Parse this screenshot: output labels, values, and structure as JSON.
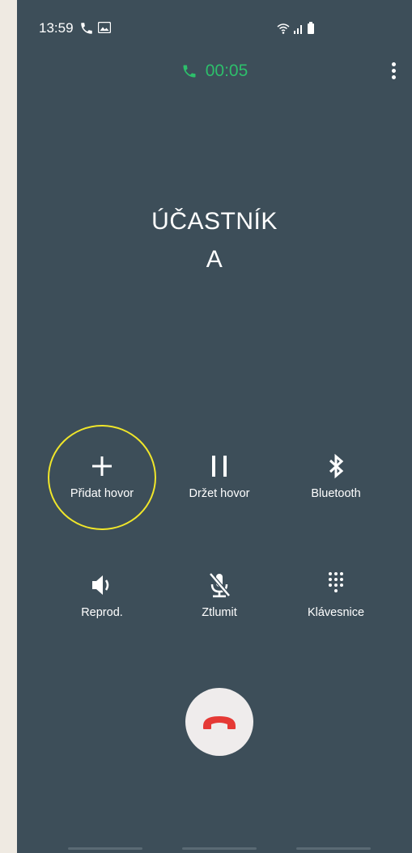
{
  "status_bar": {
    "time": "13:59",
    "left_icons": [
      "phone-icon",
      "gallery-icon"
    ],
    "right_icons": [
      "wifi-icon",
      "signal-icon",
      "battery-icon"
    ]
  },
  "call": {
    "duration": "00:05",
    "contact_line1": "ÚČASTNÍK",
    "contact_line2": "A",
    "accent_color": "#2dbf6b"
  },
  "controls": [
    {
      "id": "add-call",
      "label": "Přidat hovor",
      "icon": "plus-icon",
      "highlighted": true
    },
    {
      "id": "hold",
      "label": "Držet hovor",
      "icon": "pause-icon"
    },
    {
      "id": "bluetooth",
      "label": "Bluetooth",
      "icon": "bluetooth-icon"
    },
    {
      "id": "speaker",
      "label": "Reprod.",
      "icon": "speaker-icon"
    },
    {
      "id": "mute",
      "label": "Ztlumit",
      "icon": "mic-off-icon"
    },
    {
      "id": "keypad",
      "label": "Klávesnice",
      "icon": "keypad-icon"
    }
  ],
  "end_call": {
    "icon": "end-call-icon",
    "color": "#e53935"
  }
}
